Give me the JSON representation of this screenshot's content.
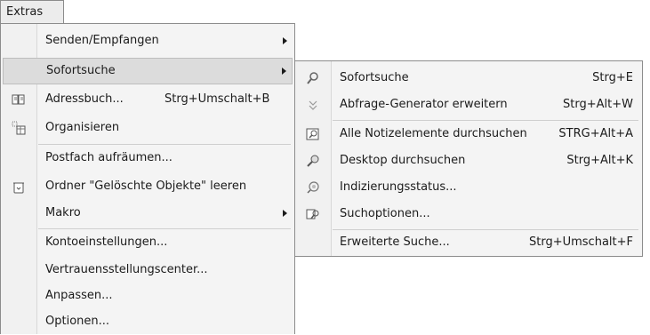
{
  "menubar": {
    "extras": "Extras"
  },
  "main_menu": {
    "senden": "Senden/Empfangen",
    "sofortsuche": "Sofortsuche",
    "adressbuch": "Adressbuch...",
    "adressbuch_shortcut": "Strg+Umschalt+B",
    "organisieren": "Organisieren",
    "postfach": "Postfach aufräumen...",
    "geloeschte": "Ordner \"Gelöschte Objekte\" leeren",
    "makro": "Makro",
    "konto": "Kontoeinstellungen...",
    "vertrauen": "Vertrauensstellungscenter...",
    "anpassen": "Anpassen...",
    "optionen": "Optionen..."
  },
  "sub_menu": {
    "sofortsuche": "Sofortsuche",
    "sofortsuche_shortcut": "Strg+E",
    "abfrage": "Abfrage-Generator erweitern",
    "abfrage_shortcut": "Strg+Alt+W",
    "alle": "Alle Notizelemente durchsuchen",
    "alle_shortcut": "STRG+Alt+A",
    "desktop": "Desktop durchsuchen",
    "desktop_shortcut": "Strg+Alt+K",
    "indizierung": "Indizierungsstatus...",
    "suchoptionen": "Suchoptionen...",
    "erweitert": "Erweiterte Suche...",
    "erweitert_shortcut": "Strg+Umschalt+F"
  }
}
